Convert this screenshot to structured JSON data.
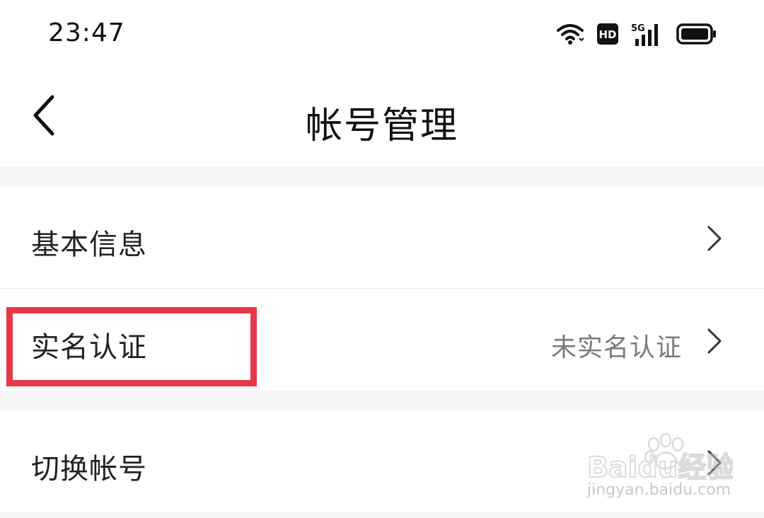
{
  "status_bar": {
    "time": "23:47",
    "icons": [
      "wifi-icon",
      "hd-icon",
      "5g-signal-icon",
      "battery-icon"
    ],
    "hd_label": "HD",
    "network_label": "5G"
  },
  "nav": {
    "title": "帐号管理",
    "back_icon": "chevron-left-icon"
  },
  "settings": {
    "items": [
      {
        "label": "基本信息",
        "value": ""
      },
      {
        "label": "实名认证",
        "value": "未实名认证"
      },
      {
        "label": "切换帐号",
        "value": ""
      }
    ]
  },
  "annotation": {
    "highlight_color": "#e8374a"
  },
  "watermark": {
    "brand": "Baidu经验",
    "url": "jingyan.baidu.com"
  }
}
